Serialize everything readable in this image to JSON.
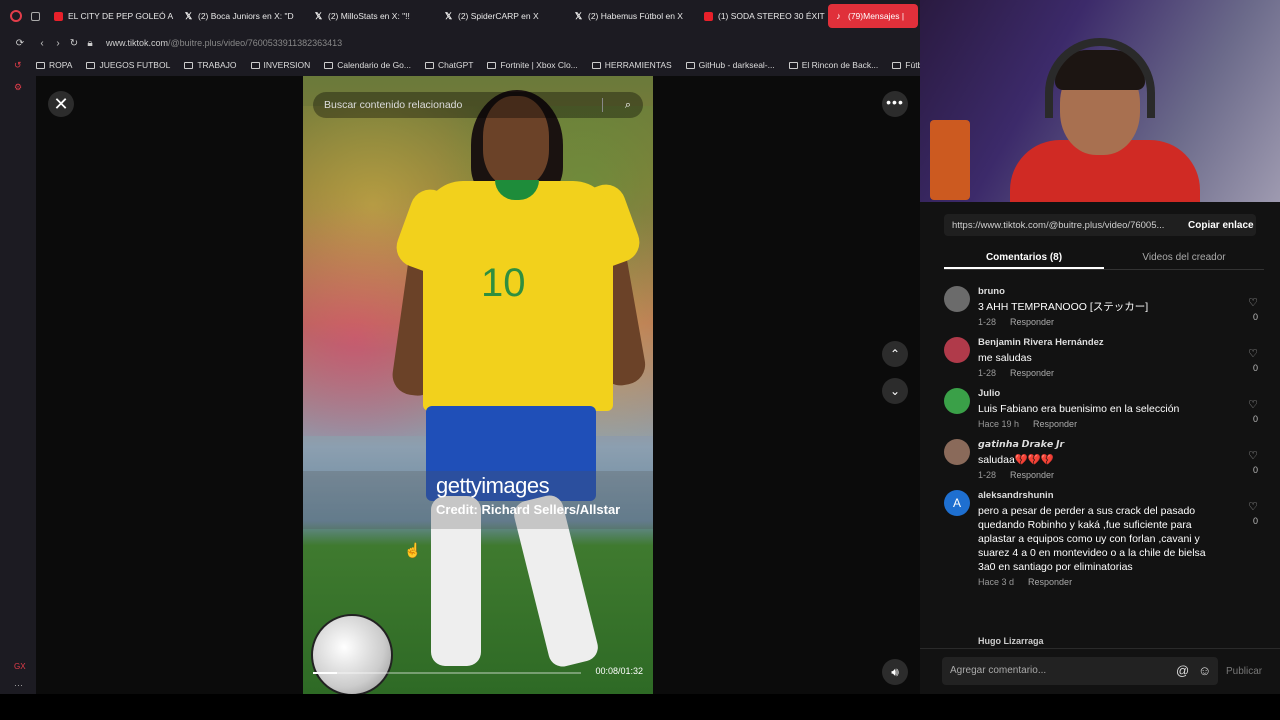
{
  "browser": {
    "tabs": [
      {
        "label": "EL CITY DE PEP GOLEÓ A",
        "fav": "youtube-icon"
      },
      {
        "label": "(2) Boca Juniors en X: \"D",
        "fav": "x-icon"
      },
      {
        "label": "(2) MilloStats en X: \"!!",
        "fav": "x-icon"
      },
      {
        "label": "(2) SpiderCARP en X",
        "fav": "x-icon"
      },
      {
        "label": "(2) Habemus Fútbol en X",
        "fav": "x-icon"
      },
      {
        "label": "(1) SODA STEREO 30 ÉXIT",
        "fav": "youtube-icon"
      },
      {
        "label": "(79)Mensajes |",
        "fav": "tiktok-icon"
      }
    ],
    "url_host": "www.tiktok.com",
    "url_path": "/@buitre.plus/video/760053391138236341​3",
    "bookmarks": [
      "ROPA",
      "JUEGOS FUTBOL",
      "TRABAJO",
      "INVERSION",
      "Calendario de Go...",
      "ChatGPT",
      "Fortnite | Xbox Clo...",
      "HERRAMIENTAS",
      "GitHub - darkseal-...",
      "El Rincon de Back...",
      "Fútbol - res"
    ]
  },
  "video": {
    "search_placeholder": "Buscar contenido relacionado",
    "watermark_brand": "gettyimages",
    "watermark_credit": "Credit: Richard Sellers/Allstar",
    "time": "00:08/01:32",
    "progress": 0.09,
    "jersey_number": "10"
  },
  "panel": {
    "link": "https://www.tiktok.com/@buitre.plus/video/76005...",
    "copy_label": "Copiar enlace",
    "tab_comments": "Comentarios (8)",
    "tab_creator": "Videos del creador",
    "reply_label": "Responder",
    "comments": [
      {
        "user": "bruno",
        "text": "3 AHH TEMPRANOOO [ステッカー]",
        "date": "1-28",
        "likes": "0",
        "avatar_color": "#6b6b6b",
        "initial": ""
      },
      {
        "user": "Benjamin Rivera Hernández",
        "text": "me saludas",
        "date": "1-28",
        "likes": "0",
        "avatar_color": "#b03a4a",
        "initial": ""
      },
      {
        "user": "Julio",
        "text": "Luis Fabiano era buenisimo en la selección",
        "date": "Hace 19 h",
        "likes": "0",
        "avatar_color": "#3aa048",
        "initial": ""
      },
      {
        "user": "𝙜𝙖𝙩𝙞𝙣𝙝𝙖 𝘿𝙧𝙖𝙠𝙚 𝙅𝙧",
        "text": "saludaa💔💔💔",
        "date": "1-28",
        "likes": "0",
        "avatar_color": "#8a6a5a",
        "initial": ""
      },
      {
        "user": "aleksandrshunin",
        "text": "pero a pesar de perder a sus crack del pasado quedando Robinho y kaká ,fue suficiente para aplastar a equipos como uy con forlan ,cavani y suarez 4 a 0 en montevideo o a la chile de bielsa 3a0 en santiago por eliminatorias",
        "date": "Hace 3 d",
        "likes": "0",
        "avatar_color": "#1e6fd0",
        "initial": "A"
      }
    ],
    "next_user": "Hugo Lizarraga",
    "composer_placeholder": "Agregar comentario...",
    "publish_label": "Publicar"
  }
}
